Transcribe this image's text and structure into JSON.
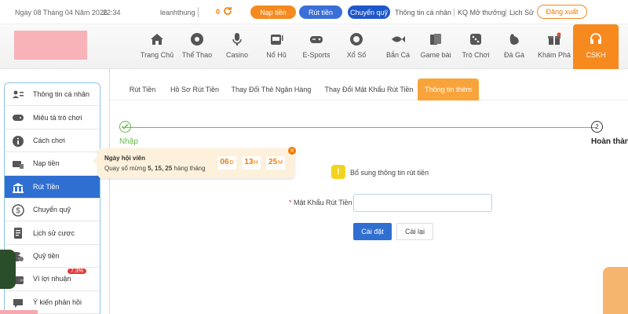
{
  "topbar": {
    "date": "Ngày 08 Tháng 04 Năm 2026",
    "time": "22:34",
    "username": "leanhthung",
    "balance": "0",
    "deposit_btn": "Nạp tiền",
    "withdraw_btn": "Rút tiền",
    "transfer_btn": "Chuyển quỹ",
    "profile_link": "Thông tin cá nhân",
    "results_link": "KQ Mở thưởng",
    "history_link": "Lịch Sử",
    "logout_btn": "Đăng xuất"
  },
  "nav": {
    "items": [
      {
        "label": "Trang Chủ",
        "icon": "home-icon"
      },
      {
        "label": "Thể Thao",
        "icon": "soccer-ball-icon"
      },
      {
        "label": "Casino",
        "icon": "microphone-icon"
      },
      {
        "label": "Nổ Hũ",
        "icon": "slot-machine-icon"
      },
      {
        "label": "E-Sports",
        "icon": "gamepad-icon"
      },
      {
        "label": "Xổ Số",
        "icon": "lottery-ball-icon"
      },
      {
        "label": "Bắn Cá",
        "icon": "fish-icon"
      },
      {
        "label": "Game bài",
        "icon": "cards-icon"
      },
      {
        "label": "Trò Chơi",
        "icon": "dice-icon"
      },
      {
        "label": "Đá Gà",
        "icon": "rooster-icon"
      },
      {
        "label": "Khám Phá",
        "icon": "gift-icon"
      },
      {
        "label": "CSKH",
        "icon": "headset-icon"
      }
    ]
  },
  "sidebar": {
    "items": [
      {
        "label": "Thông tin cá nhân",
        "icon": "user-card-icon"
      },
      {
        "label": "Miêu tả trò chơi",
        "icon": "gamepad-icon"
      },
      {
        "label": "Cách chơi",
        "icon": "info-icon"
      },
      {
        "label": "Nạp tiền",
        "icon": "deposit-icon"
      },
      {
        "label": "Rút Tiền",
        "icon": "bank-icon"
      },
      {
        "label": "Chuyển quỹ",
        "icon": "dollar-circle-icon"
      },
      {
        "label": "Lịch sử cược",
        "icon": "document-icon"
      },
      {
        "label": "Quỹ tiền",
        "icon": "coins-icon"
      },
      {
        "label": "Ví lợi nhuận",
        "icon": "wallet-icon",
        "badge": "7.3%"
      },
      {
        "label": "Ý kiến phản hồi",
        "icon": "chat-icon"
      }
    ],
    "active_index": 4
  },
  "tabs": {
    "items": [
      "Rút Tiền",
      "Hồ Sơ Rút Tiền",
      "Thay Đổi Thẻ Ngân Hàng",
      "Thay Đổi Mật Khẩu Rút Tiền",
      "Thông tin thêm"
    ],
    "active_index": 4
  },
  "steps": {
    "step1_label": "Nhập",
    "step2_number": "2",
    "step2_label": "Hoàn thành"
  },
  "form": {
    "info_text": "Bổ sung thông tin rút tiền",
    "required_mark": "*",
    "password_label": "Mật Khẩu Rút Tiền",
    "submit_btn": "Cài đặt",
    "reset_btn": "Cài lại"
  },
  "popup": {
    "title": "Ngày hội viên",
    "text_prefix": "Quay số mừng ",
    "days_highlight": "5, 15, 25",
    "text_suffix": " hàng tháng",
    "days_value": "06",
    "days_unit": "D",
    "hours_value": "13",
    "hours_unit": "H",
    "minutes_value": "25",
    "minutes_unit": "M"
  },
  "colors": {
    "accent_orange": "#f68a1f",
    "primary_blue": "#2f6fd1",
    "success_green": "#65b84a"
  }
}
